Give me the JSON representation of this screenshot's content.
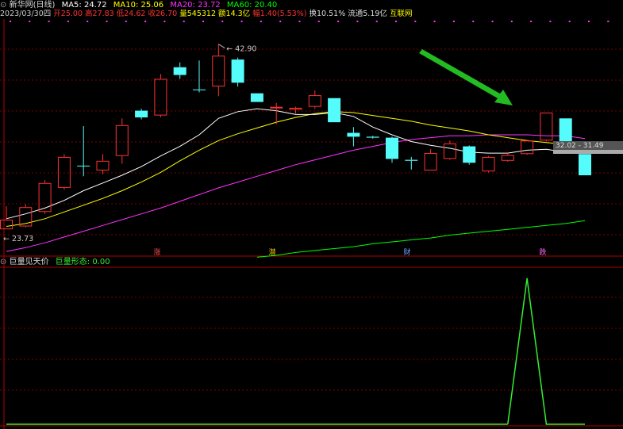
{
  "header": {
    "title": "新华网(日线)",
    "ma5": "MA5: 24.72",
    "ma10": "MA10: 25.06",
    "ma20": "MA20: 23.72",
    "ma60": "MA60: 20.40",
    "date": "2023/03/30四",
    "open": "开25.00",
    "high": "高27.83",
    "low": "低24.62",
    "close": "收26.70",
    "volume": "量545312",
    "amount": "额14.3亿",
    "change": "幅1.40(5.53%)",
    "turnover": "换10.51%",
    "float_cap": "流通5.19亿",
    "concept": "互联网"
  },
  "indicator": {
    "name": "巨量见天价",
    "label": "巨量形态: 0.00"
  },
  "colors": {
    "up": "#ff3232",
    "down": "#54fcfc",
    "ma5": "#ffffff",
    "ma10": "#ffff00",
    "ma20": "#ff33ff",
    "ma60": "#00ff00",
    "grid": "#7a0000",
    "indicator": "#33ee33",
    "arrow": "#22bb22"
  },
  "chart_data": [
    {
      "type": "candlestick",
      "annotations": {
        "max_label": "42.90",
        "min_label": "23.73",
        "range_label": "32.02 - 31.49",
        "markers": [
          "涨",
          "潜",
          "财",
          "跌"
        ]
      },
      "candles": [
        {
          "o": 23.7,
          "h": 26.1,
          "l": 23.7,
          "c": 24.7
        },
        {
          "o": 24.0,
          "h": 26.3,
          "l": 23.9,
          "c": 26.0
        },
        {
          "o": 25.5,
          "h": 28.8,
          "l": 25.3,
          "c": 28.5
        },
        {
          "o": 28.0,
          "h": 31.5,
          "l": 27.8,
          "c": 31.2
        },
        {
          "o": 30.3,
          "h": 34.4,
          "l": 29.2,
          "c": 30.3
        },
        {
          "o": 29.8,
          "h": 31.5,
          "l": 29.4,
          "c": 30.8
        },
        {
          "o": 31.3,
          "h": 35.2,
          "l": 30.5,
          "c": 34.5
        },
        {
          "o": 36.0,
          "h": 36.2,
          "l": 35.1,
          "c": 35.3
        },
        {
          "o": 35.5,
          "h": 39.8,
          "l": 35.3,
          "c": 39.3
        },
        {
          "o": 40.5,
          "h": 41.0,
          "l": 39.3,
          "c": 39.7
        },
        {
          "o": 38.2,
          "h": 41.2,
          "l": 37.9,
          "c": 38.2
        },
        {
          "o": 38.5,
          "h": 42.9,
          "l": 37.5,
          "c": 41.7
        },
        {
          "o": 41.3,
          "h": 41.5,
          "l": 38.5,
          "c": 38.9
        },
        {
          "o": 37.8,
          "h": 37.8,
          "l": 36.9,
          "c": 36.9
        },
        {
          "o": 36.3,
          "h": 36.8,
          "l": 34.6,
          "c": 36.4
        },
        {
          "o": 36.1,
          "h": 36.4,
          "l": 35.7,
          "c": 36.3
        },
        {
          "o": 36.4,
          "h": 38.1,
          "l": 36.2,
          "c": 37.6
        },
        {
          "o": 37.3,
          "h": 37.3,
          "l": 34.8,
          "c": 34.8
        },
        {
          "o": 33.7,
          "h": 34.3,
          "l": 32.3,
          "c": 33.3
        },
        {
          "o": 33.3,
          "h": 33.4,
          "l": 33.1,
          "c": 33.2
        },
        {
          "o": 33.2,
          "h": 33.3,
          "l": 30.6,
          "c": 31.0
        },
        {
          "o": 30.9,
          "h": 31.2,
          "l": 29.9,
          "c": 30.8
        },
        {
          "o": 29.8,
          "h": 32.0,
          "l": 29.8,
          "c": 31.6
        },
        {
          "o": 31.0,
          "h": 32.9,
          "l": 30.9,
          "c": 32.6
        },
        {
          "o": 32.3,
          "h": 32.4,
          "l": 30.4,
          "c": 30.6
        },
        {
          "o": 29.7,
          "h": 31.3,
          "l": 29.6,
          "c": 31.2
        },
        {
          "o": 30.8,
          "h": 31.7,
          "l": 30.7,
          "c": 31.4
        },
        {
          "o": 31.5,
          "h": 33.0,
          "l": 31.4,
          "c": 32.9
        },
        {
          "o": 32.9,
          "h": 35.8,
          "l": 32.8,
          "c": 35.8
        },
        {
          "o": 35.2,
          "h": 35.2,
          "l": 32.0,
          "c": 32.0
        },
        {
          "o": 31.5,
          "h": 31.5,
          "l": 29.3,
          "c": 29.3
        }
      ],
      "ma5": [
        24.8,
        25.3,
        25.9,
        26.7,
        27.7,
        28.5,
        29.3,
        30.2,
        31.3,
        32.3,
        33.5,
        35.2,
        35.9,
        36.2,
        36.0,
        35.6,
        35.6,
        35.8,
        35.4,
        34.3,
        33.5,
        32.8,
        32.4,
        32.1,
        31.7,
        31.6,
        31.6,
        31.9,
        32.0,
        31.7,
        31.6
      ],
      "ma10": [
        24.0,
        24.3,
        24.8,
        25.5,
        26.2,
        26.9,
        27.7,
        28.6,
        29.6,
        30.8,
        31.9,
        32.9,
        33.6,
        34.2,
        34.8,
        35.3,
        35.7,
        35.9,
        35.8,
        35.5,
        35.2,
        34.9,
        34.5,
        34.2,
        33.9,
        33.5,
        33.2,
        32.9,
        32.7,
        32.5,
        32.3
      ],
      "ma20": [
        21.4,
        21.8,
        22.3,
        22.9,
        23.5,
        24.1,
        24.7,
        25.3,
        25.9,
        26.6,
        27.3,
        28.0,
        28.6,
        29.2,
        29.8,
        30.4,
        30.9,
        31.4,
        31.9,
        32.3,
        32.7,
        33.0,
        33.2,
        33.4,
        33.4,
        33.5,
        33.5,
        33.5,
        33.4,
        33.4,
        33.1
      ],
      "ma60_start": 13,
      "ma60": [
        20.8,
        21.0,
        21.3,
        21.5,
        21.7,
        21.9,
        22.2,
        22.4,
        22.6,
        22.8,
        23.1,
        23.3,
        23.5,
        23.7,
        23.9,
        24.1,
        24.3,
        24.6
      ],
      "ylim": [
        21.0,
        45.5
      ]
    },
    {
      "type": "line",
      "name": "巨量形态",
      "start_index": 26,
      "values": [
        0,
        1,
        0,
        0,
        0
      ],
      "ylim": [
        0,
        1.07
      ]
    }
  ]
}
